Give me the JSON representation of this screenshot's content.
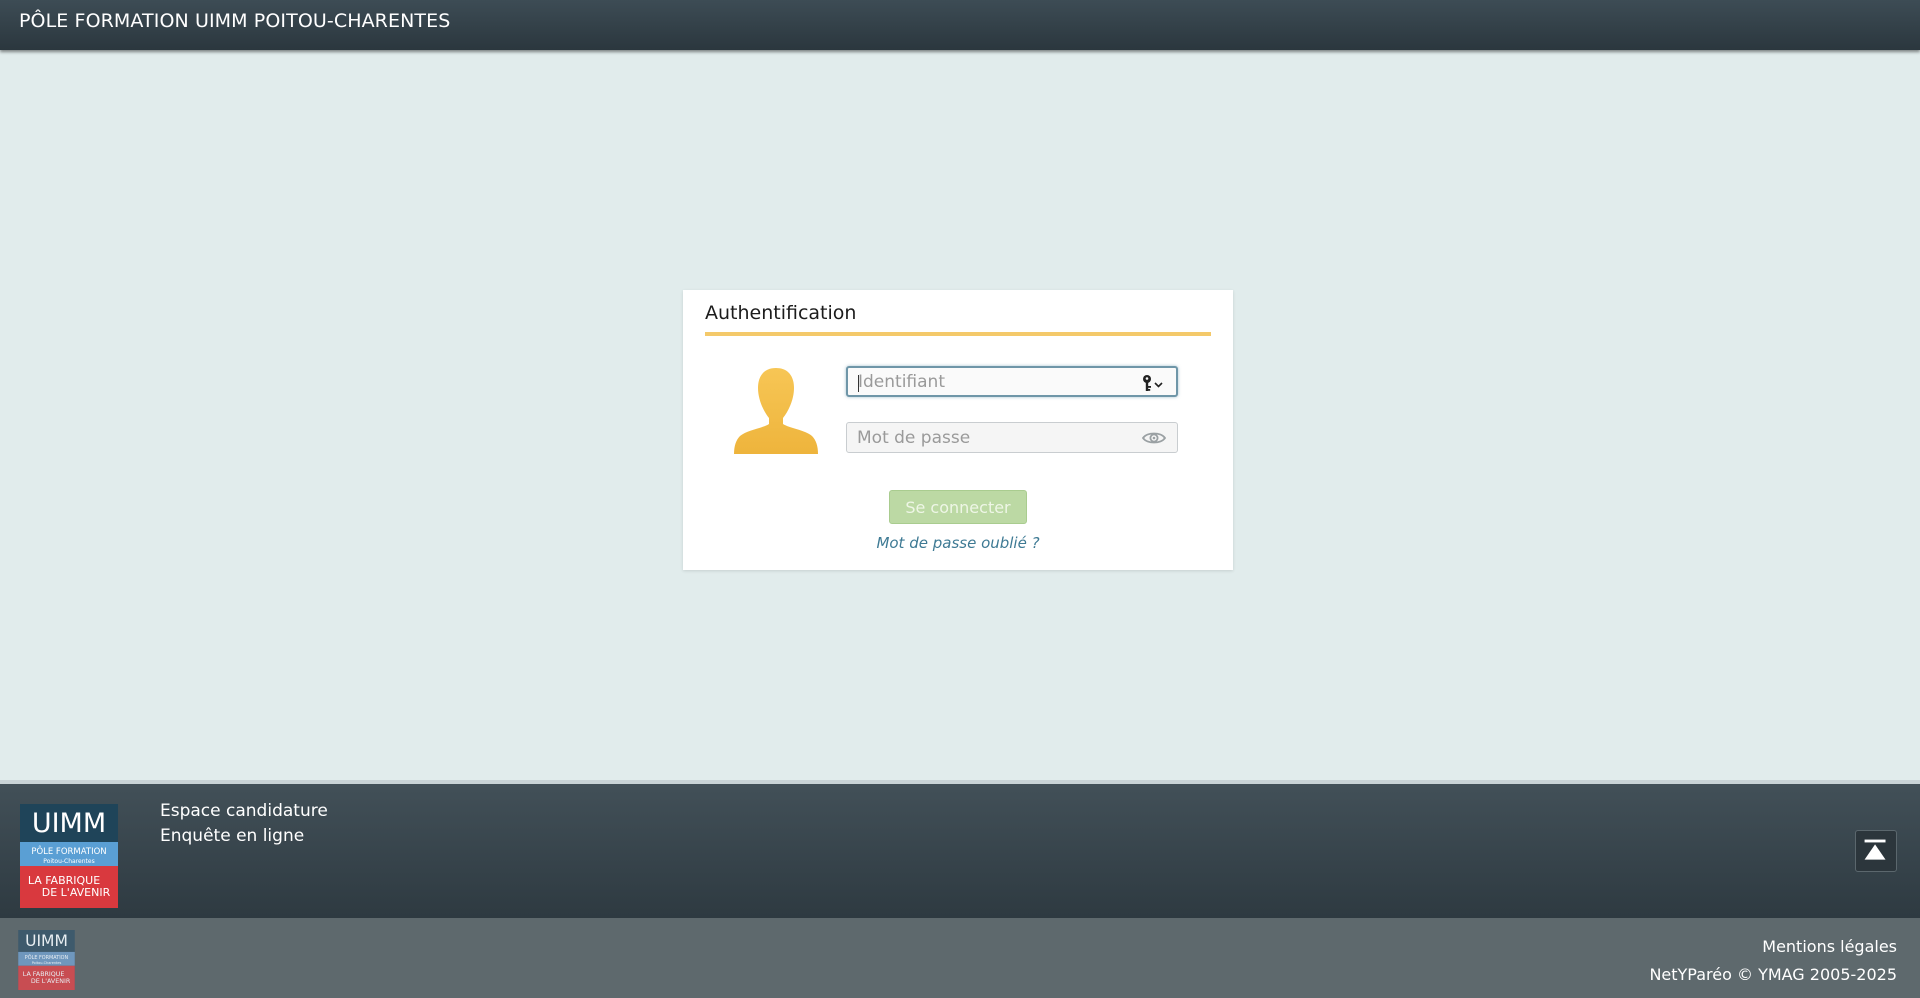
{
  "header": {
    "title": "PÔLE FORMATION UIMM POITOU-CHARENTES"
  },
  "login": {
    "title": "Authentification",
    "username_placeholder": "Identifiant",
    "username_value": "",
    "password_placeholder": "Mot de passe",
    "password_value": "",
    "submit_label": "Se connecter",
    "forgot_label": "Mot de passe oublié ?"
  },
  "footer": {
    "links": [
      {
        "label": "Espace candidature"
      },
      {
        "label": "Enquête en ligne"
      }
    ],
    "logo": {
      "main_text": "UIMM",
      "band_text": "PÔLE FORMATION",
      "band_subtext": "Poitou-Charentes",
      "tagline_line1": "LA FABRIQUE",
      "tagline_line2": "DE L'AVENIR"
    },
    "legal_label": "Mentions légales",
    "copyright": "NetYParéo © YMAG 2005-2025"
  },
  "icons": {
    "avatar": "user-silhouette-icon",
    "username_suffix": "key-dropdown-icon",
    "password_suffix": "eye-icon",
    "to_top": "scroll-to-top-icon"
  },
  "colors": {
    "accent_yellow": "#f4c96a",
    "avatar_yellow": "#f2be4b",
    "button_green": "#bcd9a4",
    "link_blue": "#3e7a94",
    "header_dark": "#2e3a41",
    "background": "#e1ecec"
  }
}
